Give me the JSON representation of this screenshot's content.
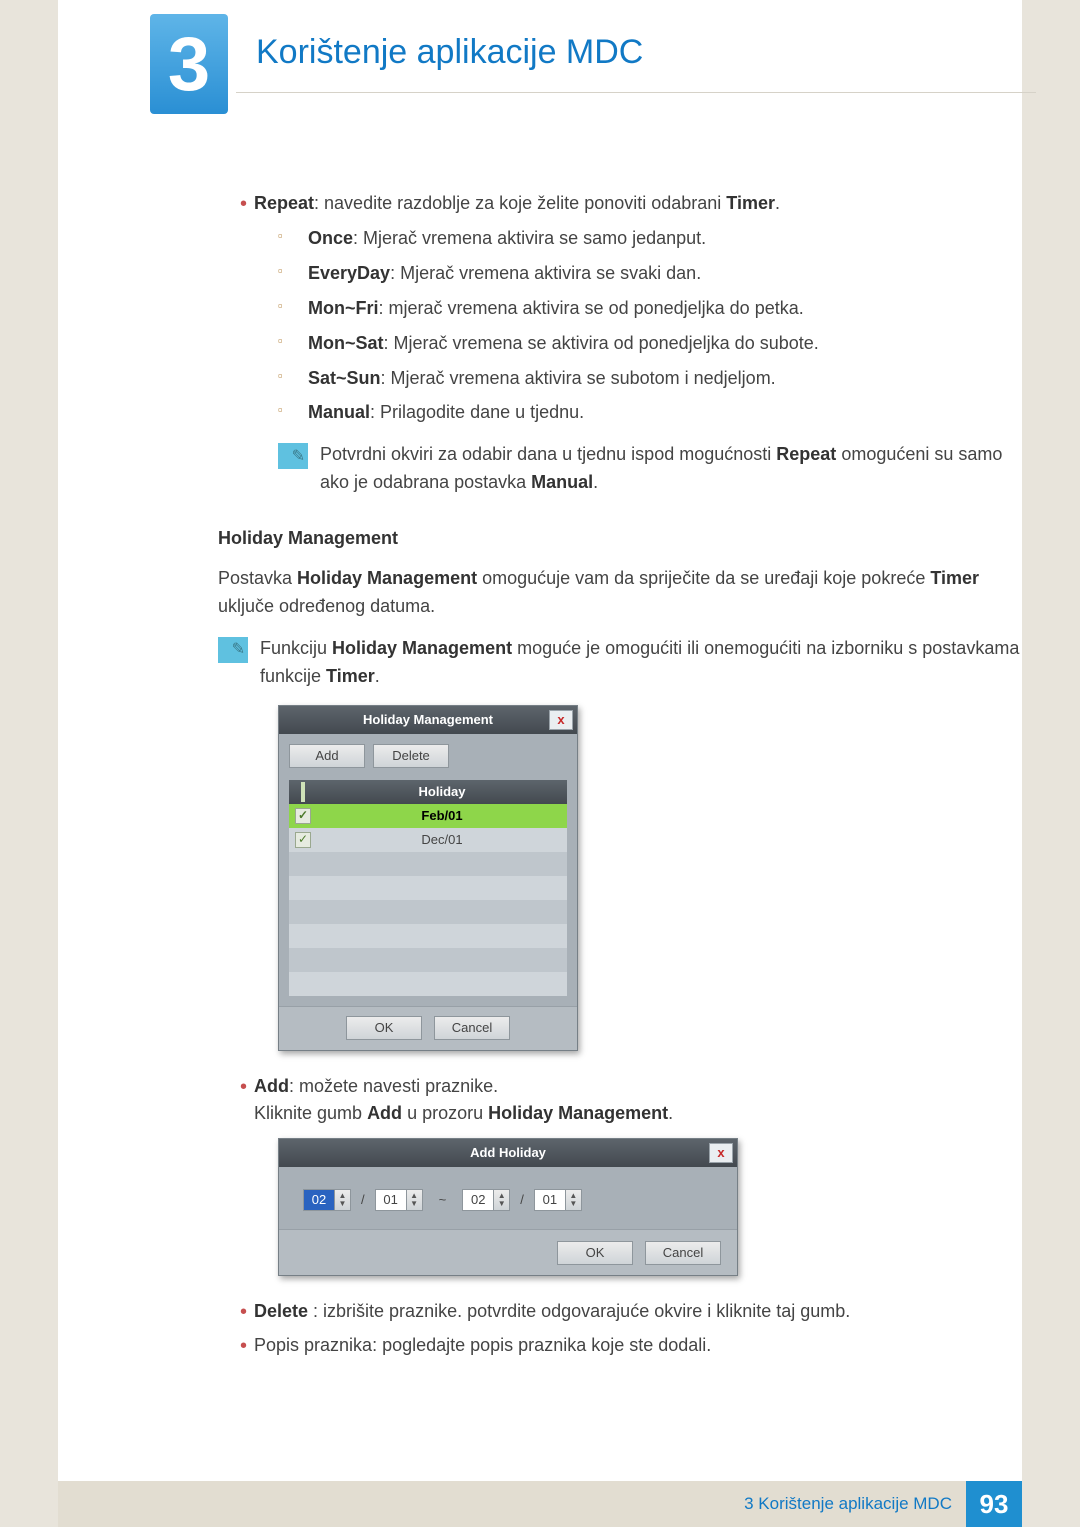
{
  "header": {
    "chapter_num": "3",
    "chapter_title": "Korištenje aplikacije MDC"
  },
  "repeat": {
    "bold": "Repeat",
    "text": ": navedite razdoblje za koje želite ponoviti odabrani ",
    "tail_bold": "Timer",
    "items": [
      {
        "bold": "Once",
        "text": ": Mjerač vremena aktivira se samo jedanput."
      },
      {
        "bold": "EveryDay",
        "text": ": Mjerač vremena aktivira se svaki dan."
      },
      {
        "bold": "Mon~Fri",
        "text": ": mjerač vremena aktivira se od ponedjeljka do petka."
      },
      {
        "bold": "Mon~Sat",
        "text": ": Mjerač vremena se aktivira od ponedjeljka do subote."
      },
      {
        "bold": "Sat~Sun",
        "text": ": Mjerač vremena aktivira se subotom i nedjeljom."
      },
      {
        "bold": "Manual",
        "text": ": Prilagodite dane u tjednu."
      }
    ],
    "note_pre": "Potvrdni okviri za odabir dana u tjednu ispod mogućnosti ",
    "note_bold1": "Repeat",
    "note_mid": " omogućeni su samo ako je odabrana postavka ",
    "note_bold2": "Manual",
    "note_suf": "."
  },
  "hm_section": {
    "heading": "Holiday Management",
    "para_pre": "Postavka ",
    "para_b1": "Holiday Management",
    "para_mid": " omogućuje vam da spriječite da se uređaji koje pokreće ",
    "para_b2": "Timer",
    "para_suf": " uključe određenog datuma.",
    "note_pre": "Funkciju ",
    "note_b1": "Holiday Management",
    "note_mid": " moguće je omogućiti ili onemogućiti na izborniku s postavkama funkcije ",
    "note_b2": "Timer",
    "note_suf": "."
  },
  "hm_dialog": {
    "title": "Holiday Management",
    "close": "x",
    "btn_add": "Add",
    "btn_delete": "Delete",
    "col_holiday": "Holiday",
    "rows": [
      {
        "checked": true,
        "label": "Feb/01",
        "selected": true
      },
      {
        "checked": true,
        "label": "Dec/01",
        "selected": false
      }
    ],
    "btn_ok": "OK",
    "btn_cancel": "Cancel"
  },
  "add_section": {
    "bold": "Add",
    "text": ": možete navesti praznike.",
    "line2_pre": "Kliknite gumb ",
    "line2_b1": "Add",
    "line2_mid": " u prozoru ",
    "line2_b2": "Holiday Management",
    "line2_suf": "."
  },
  "ah_dialog": {
    "title": "Add Holiday",
    "close": "x",
    "from_month": "02",
    "from_day": "01",
    "tilde": "~",
    "to_month": "02",
    "to_day": "01",
    "slash": "/",
    "btn_ok": "OK",
    "btn_cancel": "Cancel"
  },
  "delete_item": {
    "bold": "Delete ",
    "text": ": izbrišite praznike. potvrdite odgovarajuće okvire i kliknite taj gumb."
  },
  "list_item": {
    "text": "Popis praznika: pogledajte popis praznika koje ste dodali."
  },
  "footer": {
    "text": "3 Korištenje aplikacije MDC",
    "page": "93"
  }
}
